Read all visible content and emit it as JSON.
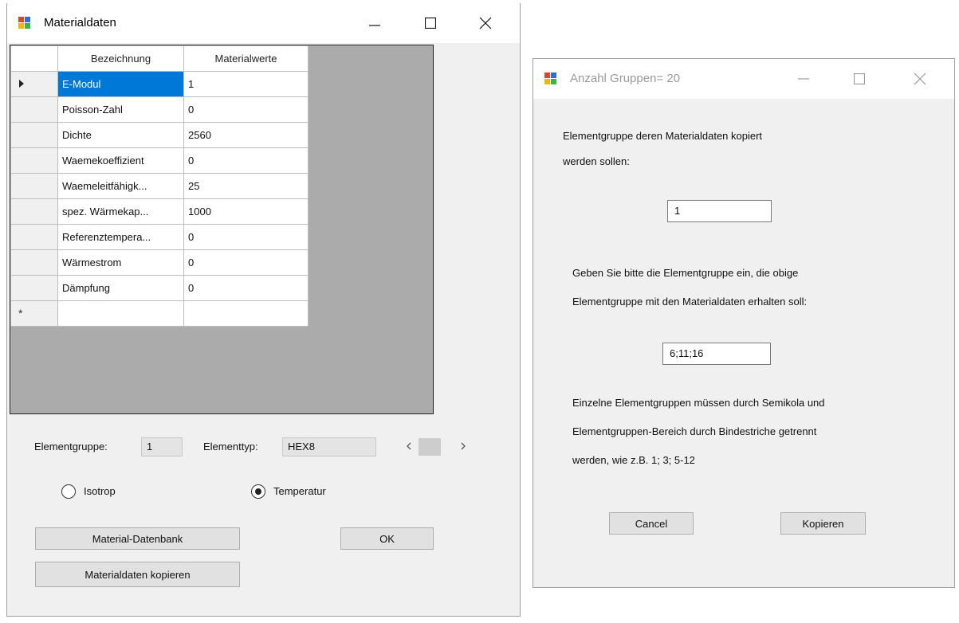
{
  "main_window": {
    "title": "Materialdaten",
    "grid": {
      "headers": [
        "Bezeichnung",
        "Materialwerte"
      ],
      "rows": [
        {
          "name": "E-Modul",
          "value": "1"
        },
        {
          "name": "Poisson-Zahl",
          "value": "0"
        },
        {
          "name": "Dichte",
          "value": "2560"
        },
        {
          "name": "Waemekoeffizient",
          "value": "0"
        },
        {
          "name": "Waemeleitfähigk...",
          "value": "25"
        },
        {
          "name": "spez. Wärmekap...",
          "value": "1000"
        },
        {
          "name": "Referenztempera...",
          "value": "0"
        },
        {
          "name": "Wärmestrom",
          "value": "0"
        },
        {
          "name": "Dämpfung",
          "value": "0"
        }
      ],
      "new_row_marker": "*"
    },
    "elementgruppe_label": "Elementgruppe:",
    "elementgruppe_value": "1",
    "elementtyp_label": "Elementtyp:",
    "elementtyp_value": "HEX8",
    "radio_isotrop": "Isotrop",
    "radio_temperatur": "Temperatur",
    "selected_radio": "Temperatur",
    "btn_material_db": "Material-Datenbank",
    "btn_ok": "OK",
    "btn_copy": "Materialdaten kopieren"
  },
  "dialog": {
    "title": "Anzahl Gruppen=  20",
    "prompt1_line1": "Elementgruppe deren Materialdaten kopiert",
    "prompt1_line2": "werden sollen:",
    "source_value": "1",
    "prompt2_line1": "Geben Sie bitte die Elementgruppe ein, die obige",
    "prompt2_line2": "Elementgruppe mit den Materialdaten erhalten soll:",
    "target_value": "6;11;16",
    "hint_line1": "Einzelne Elementgruppen müssen durch Semikola und",
    "hint_line2": "Elementgruppen-Bereich durch Bindestriche getrennt",
    "hint_line3": "werden, wie z.B. 1; 3; 5-12",
    "btn_cancel": "Cancel",
    "btn_copy": "Kopieren"
  },
  "colors": {
    "selection": "#0078d7",
    "window_bg": "#f0f0f0",
    "grid_bg": "#ababab"
  },
  "icons": {
    "app": "windows-forms-app-icon",
    "minimize": "minimize-icon",
    "maximize": "maximize-icon",
    "close": "close-icon"
  }
}
